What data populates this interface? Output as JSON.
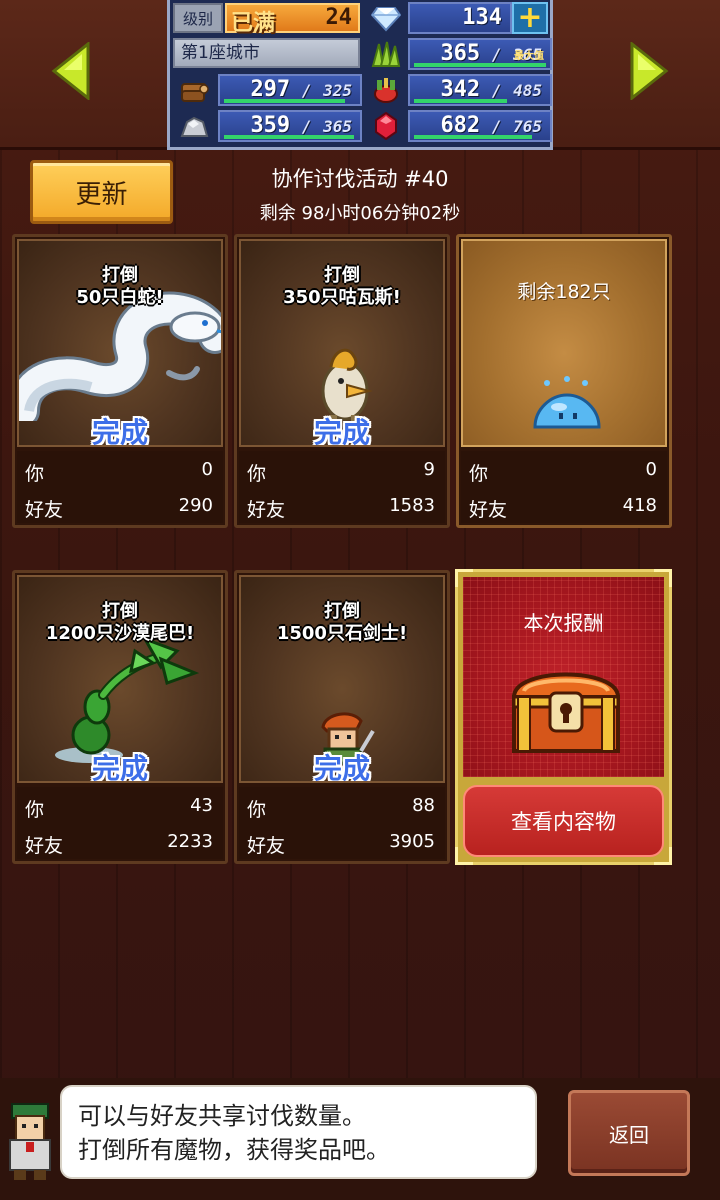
{
  "header": {
    "level_label": "级别",
    "level_status": "已满",
    "level_value": "24",
    "gems": "134",
    "plus": "+",
    "city_name": "第1座城市",
    "resources": [
      {
        "icon": "grass-icon",
        "value": "365",
        "max": "365",
        "note": "最大值",
        "fill": 1.0
      },
      {
        "icon": "wood-icon",
        "value": "297",
        "max": "325",
        "fill": 0.914
      },
      {
        "icon": "food-icon",
        "value": "342",
        "max": "485",
        "fill": 0.705
      },
      {
        "icon": "ore-icon",
        "value": "359",
        "max": "365",
        "fill": 0.984
      },
      {
        "icon": "ruby-icon",
        "value": "682",
        "max": "765",
        "fill": 0.892
      }
    ]
  },
  "event": {
    "update_label": "更新",
    "title": "协作讨伐活动 #40",
    "timer": "剩余 98小时06分钟02秒"
  },
  "cards": [
    {
      "line1": "打倒",
      "line2": "50只白蛇!",
      "status": "完成",
      "you_label": "你",
      "you": "0",
      "friend_label": "好友",
      "friend": "290",
      "monster": "white-snake"
    },
    {
      "line1": "打倒",
      "line2": "350只咕瓦斯!",
      "status": "完成",
      "you_label": "你",
      "you": "9",
      "friend_label": "好友",
      "friend": "1583",
      "monster": "kuwasu"
    },
    {
      "remaining": "剩余182只",
      "you_label": "你",
      "you": "0",
      "friend_label": "好友",
      "friend": "418",
      "monster": "blue-slime"
    },
    {
      "line1": "打倒",
      "line2": "1200只沙漠尾巴!",
      "status": "完成",
      "you_label": "你",
      "you": "43",
      "friend_label": "好友",
      "friend": "2233",
      "monster": "desert-tail"
    },
    {
      "line1": "打倒",
      "line2": "1500只石剑士!",
      "status": "完成",
      "you_label": "你",
      "you": "88",
      "friend_label": "好友",
      "friend": "3905",
      "monster": "stone-swordsman"
    }
  ],
  "reward": {
    "title": "本次报酬",
    "view_label": "查看内容物"
  },
  "dialog": {
    "line1": "可以与好友共享讨伐数量。",
    "line2": "打倒所有魔物，获得奖品吧。"
  },
  "back_label": "返回",
  "colors": {
    "accent_gold": "#f3a929",
    "done_blue": "#3d6ee8",
    "reward_red": "#b8221f",
    "bar_green": "#33d46a"
  }
}
